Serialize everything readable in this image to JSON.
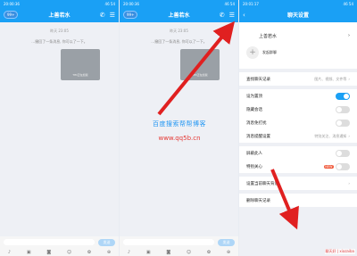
{
  "status_bar": {
    "time": "20:00:36",
    "time_right": "20:01:17",
    "net": "46 54"
  },
  "chat": {
    "back_label": "99+",
    "title": "上善若水",
    "timestamp": "昨天 23:05",
    "system_tip": "…撤回了一条消息, 你可以了一下。",
    "image_caption": "TIM正在加载",
    "send_label": "发送",
    "toolbar_icons": [
      "mic-icon",
      "image-icon",
      "camera-icon",
      "emoji-icon",
      "gift-icon",
      "plus-icon"
    ]
  },
  "settings": {
    "title": "聊天设置",
    "member_name": "上善若水",
    "add_group_label": "发起群聊",
    "search_history": "查找聊天记录",
    "search_hint": "图片、视频、文件等",
    "pin_chat": "设为置顶",
    "hide_chat": "隐藏会话",
    "do_not_disturb": "消息免打扰",
    "msg_alert": "消息提醒设置",
    "msg_alert_hint": "特别关注、消息通知",
    "block": "屏蔽此人",
    "special_care": "特别关心",
    "special_badge": "NEW",
    "chat_background": "设置当前聊天背景",
    "delete_history": "删除聊天记录",
    "pin_on": true
  },
  "watermark": {
    "line1": "百度搜索帮帮博客",
    "line2": "www.qq5b.cn"
  },
  "corner_mark": "聊天好 | xiazaiba"
}
